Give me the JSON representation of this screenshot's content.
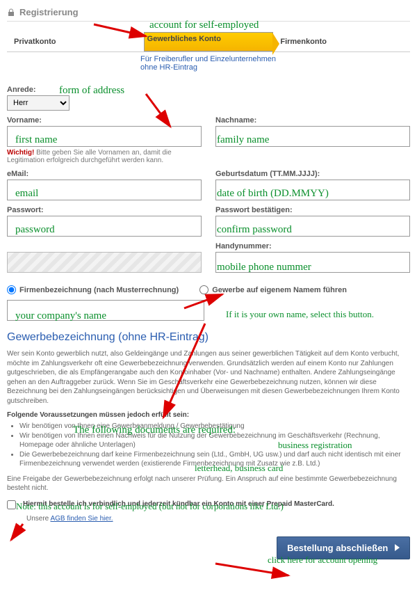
{
  "header": {
    "title": "Registrierung"
  },
  "tabs": {
    "privat": "Privatkonto",
    "gewerblich": "Gewerbliches Konto",
    "firma": "Firmenkonto",
    "subtitle": "Für Freiberufler und Einzelunternehmen ohne HR-Eintrag"
  },
  "form": {
    "anrede_label": "Anrede:",
    "anrede_value": "Herr",
    "vorname_label": "Vorname:",
    "nachname_label": "Nachname:",
    "vorname_hint_prefix": "Wichtig!",
    "vorname_hint_rest": " Bitte geben Sie alle Vornamen an, damit die Legitimation erfolgreich durchgeführt werden kann.",
    "email_label": "eMail:",
    "geb_label": "Geburtsdatum (TT.MM.JJJJ):",
    "pw_label": "Passwort:",
    "pw2_label": "Passwort bestätigen:",
    "handy_label": "Handynummer:",
    "radio1": "Firmenbezeichnung (nach Musterrechnung)",
    "radio2": "Gewerbe auf eigenem Namem führen"
  },
  "section": {
    "heading": "Gewerbebezeichnung (ohne HR-Eintrag)",
    "para": "Wer sein Konto gewerblich nutzt, also Geldeingänge und Zahlungen aus seiner gewerblichen Tätigkeit auf dem Konto verbucht, möchte im Zahlungsverkehr oft eine Gewerbebezeichnung verwenden. Grundsätzlich werden auf einem Konto nur Zahlungen gutgeschrieben, die als Empfängerangabe auch den Kontoinhaber (Vor- und Nachname) enthalten. Andere Zahlungseingänge gehen an den Auftraggeber zurück. Wenn Sie im Geschäftsverkehr eine Gewerbebezeichnung nutzen, können wir diese Bezeichnung bei den Zahlungseingängen berücksichtigen und Überweisungen mit diesen Gewerbebezeichnungen Ihrem Konto gutschreiben.",
    "req_head": "Folgende Voraussetzungen müssen jedoch erfüllt sein:",
    "req1": "Wir benötigen von Ihnen eine Gewerbeanmeldung / Gewerbebestätigung",
    "req2": "Wir benötigen von Ihnen einen Nachweis für die Nutzung der Gewerbebezeichnung im Geschäftsverkehr (Rechnung, Homepage oder ähnliche Unterlagen)",
    "req3": "Die Gewerbebezeichnung darf keine Firmenbezeichnung sein (Ltd., GmbH, UG usw.) und darf auch nicht identisch mit einer Firmenbezeichnung verwendet werden (existierende Firmenbezeichnung mit Zusatz wie z.B. Ltd.)",
    "freigabe": "Eine Freigabe der Gewerbebezeichnung erfolgt nach unserer Prüfung. Ein Anspruch auf eine bestimmte Gewerbebezeichnung besteht nicht.",
    "consent": "Hiermit bestelle ich verbindlich und jederzeit kündbar ein Konto mit einer Prepaid MasterCard.",
    "agb_prefix": "Unsere ",
    "agb_link": "AGB finden Sie hier."
  },
  "button": {
    "submit": "Bestellung abschließen"
  },
  "annotations": {
    "self_employed": "account for self-employed",
    "form_of_address": "form of address",
    "first_name": "first name",
    "family_name": "family name",
    "email": "email",
    "dob": "date of birth",
    "dob_fmt": "(DD.MMYY)",
    "password": "password",
    "confirm_password": "confirm password",
    "mobile": "mobile phone nummer",
    "company": "your company's name",
    "own_name": "If it is your own name, select this button.",
    "req_docs": "The following documents are required:",
    "biz_reg": "business registration",
    "letterhead": "letterhead, business card",
    "note": "Note: this account is for self-employed (but not for corporations like Ltd.)",
    "click_here": "click here for account opening"
  }
}
